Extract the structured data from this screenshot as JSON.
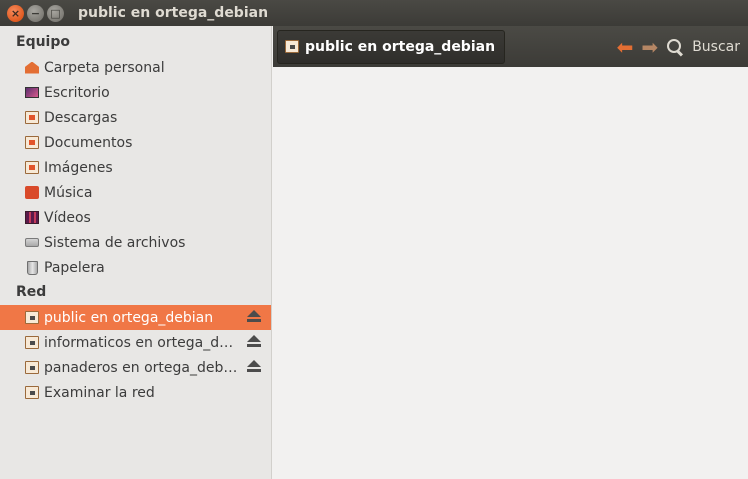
{
  "window": {
    "title": "public en ortega_debian"
  },
  "sidebar": {
    "sections": [
      {
        "title": "Equipo",
        "items": [
          {
            "label": "Carpeta personal",
            "icon": "home-folder-icon"
          },
          {
            "label": "Escritorio",
            "icon": "desktop-icon"
          },
          {
            "label": "Descargas",
            "icon": "downloads-folder-icon"
          },
          {
            "label": "Documentos",
            "icon": "documents-folder-icon"
          },
          {
            "label": "Imágenes",
            "icon": "pictures-folder-icon"
          },
          {
            "label": "Música",
            "icon": "music-folder-icon"
          },
          {
            "label": "Vídeos",
            "icon": "videos-folder-icon"
          },
          {
            "label": "Sistema de archivos",
            "icon": "filesystem-icon"
          },
          {
            "label": "Papelera",
            "icon": "trash-icon"
          }
        ]
      },
      {
        "title": "Red",
        "items": [
          {
            "label": "public en ortega_debian",
            "icon": "network-folder-icon",
            "active": true,
            "ejectable": true
          },
          {
            "label": "informaticos en ortega_de…",
            "icon": "network-folder-icon",
            "ejectable": true
          },
          {
            "label": "panaderos en ortega_debian",
            "icon": "network-folder-icon",
            "ejectable": true
          },
          {
            "label": "Examinar la red",
            "icon": "network-browse-icon"
          }
        ]
      }
    ]
  },
  "toolbar": {
    "path_label": "public en ortega_debian",
    "search_label": "Buscar"
  },
  "colors": {
    "accent": "#f07746",
    "titlebar": "#3c3b37",
    "sidebar_bg": "#e8e7e5",
    "content_bg": "#f2f1f0"
  }
}
